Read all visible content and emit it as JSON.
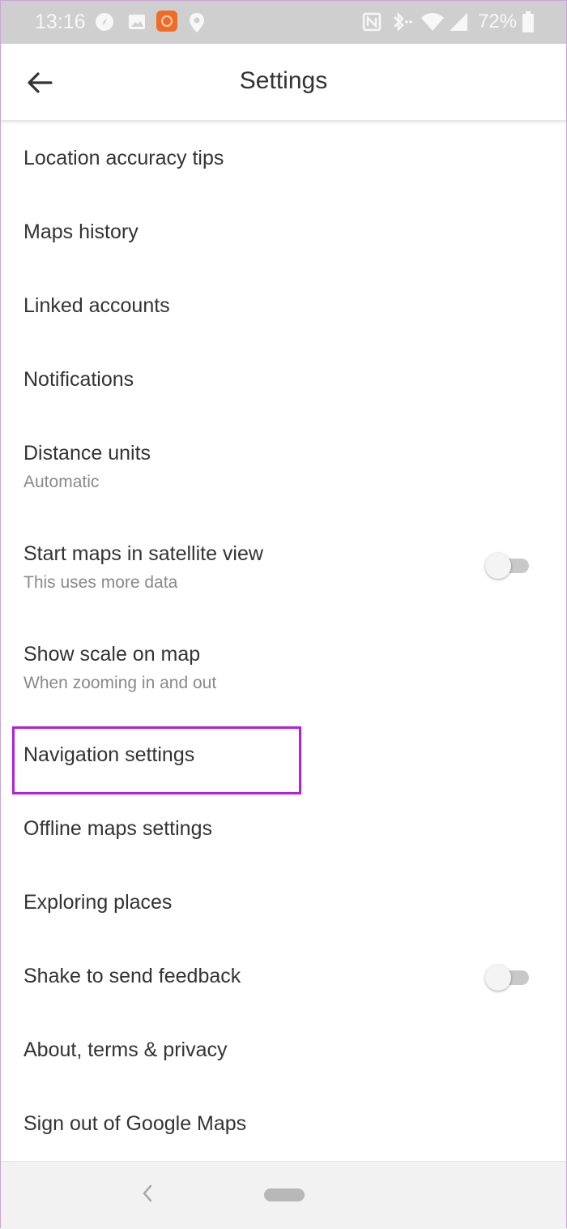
{
  "status_bar": {
    "time": "13:16",
    "battery": "72%",
    "icons": [
      "compass-icon",
      "image-icon",
      "app-notification-icon",
      "location-pin-icon",
      "nfc-icon",
      "bluetooth-icon",
      "wifi-icon",
      "cell-signal-icon",
      "battery-icon"
    ],
    "accent_notification": "#f06a28"
  },
  "app_bar": {
    "title": "Settings",
    "back_icon": "arrow-back-icon"
  },
  "settings": [
    {
      "label": "Location accuracy tips"
    },
    {
      "label": "Maps history"
    },
    {
      "label": "Linked accounts"
    },
    {
      "label": "Notifications"
    },
    {
      "label": "Distance units",
      "sub": "Automatic"
    },
    {
      "label": "Start maps in satellite view",
      "sub": "This uses more data",
      "toggle": false
    },
    {
      "label": "Show scale on map",
      "sub": "When zooming in and out"
    },
    {
      "label": "Navigation settings",
      "highlighted": true
    },
    {
      "label": "Offline maps settings"
    },
    {
      "label": "Exploring places"
    },
    {
      "label": "Shake to send feedback",
      "toggle": false
    },
    {
      "label": "About, terms & privacy"
    },
    {
      "label": "Sign out of Google Maps"
    }
  ],
  "colors": {
    "highlight_border": "#b31ee0",
    "status_bar_bg": "#cfcfcf"
  },
  "nav_bar": {
    "icons": [
      "nav-back-icon",
      "nav-home-pill-icon"
    ]
  }
}
